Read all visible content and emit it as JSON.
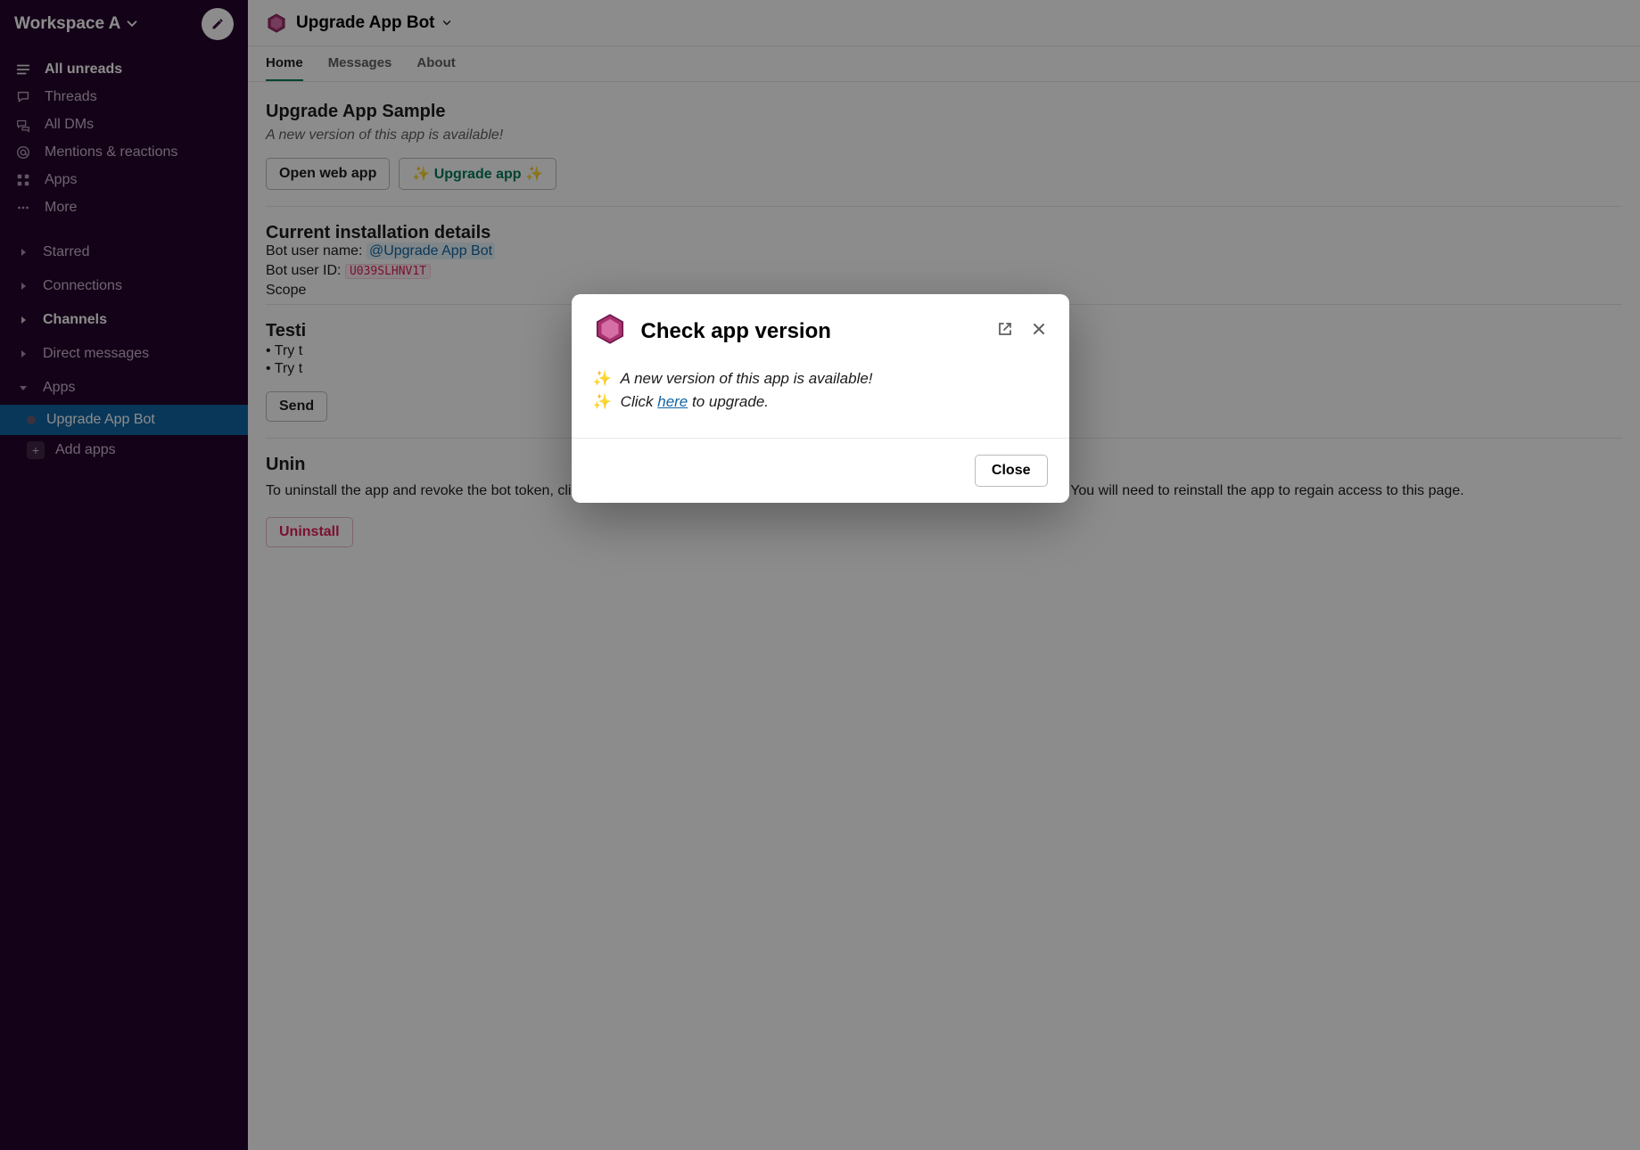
{
  "workspace": {
    "name": "Workspace A"
  },
  "sidebar": {
    "nav": [
      {
        "label": "All unreads",
        "bold": true,
        "icon": "list"
      },
      {
        "label": "Threads",
        "icon": "thread"
      },
      {
        "label": "All DMs",
        "icon": "dm"
      },
      {
        "label": "Mentions & reactions",
        "icon": "mention"
      },
      {
        "label": "Apps",
        "icon": "grid"
      },
      {
        "label": "More",
        "icon": "more"
      }
    ],
    "sections": [
      {
        "label": "Starred",
        "collapsed": true
      },
      {
        "label": "Connections",
        "collapsed": true
      },
      {
        "label": "Channels",
        "collapsed": true,
        "bold": true
      },
      {
        "label": "Direct messages",
        "collapsed": true
      },
      {
        "label": "Apps",
        "collapsed": false
      }
    ],
    "apps_items": [
      {
        "label": "Upgrade App Bot",
        "active": true
      }
    ],
    "add_apps": "Add apps"
  },
  "header": {
    "title": "Upgrade App Bot"
  },
  "tabs": [
    {
      "label": "Home",
      "active": true
    },
    {
      "label": "Messages"
    },
    {
      "label": "About"
    }
  ],
  "home": {
    "title": "Upgrade App Sample",
    "subtitle": "A new version of this app is available!",
    "open_btn": "Open web app",
    "upgrade_btn": "Upgrade app",
    "sparkle": "✨",
    "install_title": "Current installation details",
    "bot_user_label": "Bot user name:",
    "bot_user_value": "@Upgrade App Bot",
    "bot_id_label": "Bot user ID:",
    "bot_id_value": "U039SLHNV1T",
    "scopes_label": "Scope",
    "testing_title": "Testi",
    "test_line_prefix": "• Try t",
    "send_btn_prefix": "Send",
    "uninstall_title_prefix": "Unin",
    "uninstall_text": "To uninstall the app and revoke the bot token, click the button below. The app will be uninstalled for all users on the workspace. You will need to reinstall the app to regain access to this page.",
    "uninstall_btn": "Uninstall"
  },
  "modal": {
    "title": "Check app version",
    "line1": "A new version of this app is available!",
    "line2_pre": "Click ",
    "line2_link": "here",
    "line2_post": " to upgrade.",
    "close": "Close",
    "sparkle": "✨"
  }
}
